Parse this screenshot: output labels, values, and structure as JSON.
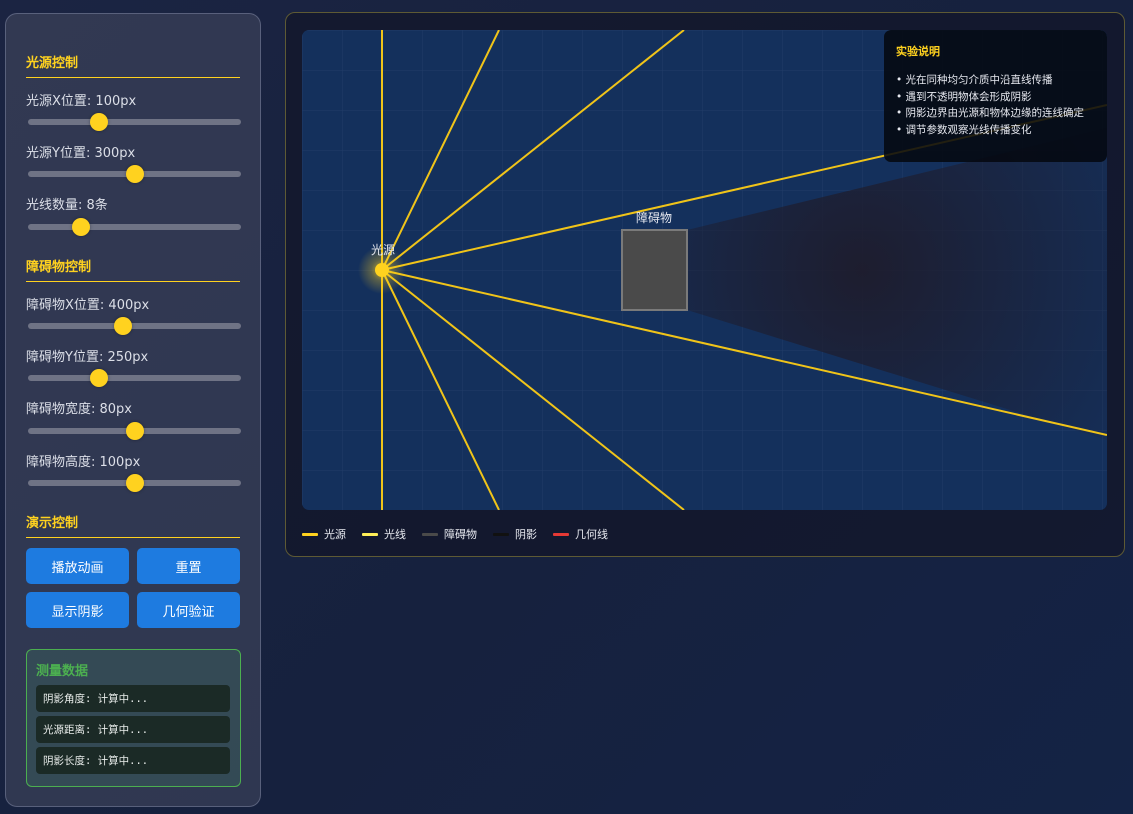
{
  "sidebar": {
    "light_section_title": "光源控制",
    "light_x": {
      "label": "光源X位置: 100px",
      "value": 100,
      "min": 0,
      "max": 300
    },
    "light_y": {
      "label": "光源Y位置: 300px",
      "value": 300,
      "min": 0,
      "max": 600
    },
    "ray_count": {
      "label": "光线数量: 8条",
      "value": 8,
      "min": 2,
      "max": 26
    },
    "obstacle_section_title": "障碍物控制",
    "obstacle_x": {
      "label": "障碍物X位置: 400px",
      "value": 400,
      "min": 0,
      "max": 900
    },
    "obstacle_y": {
      "label": "障碍物Y位置: 250px",
      "value": 250,
      "min": 0,
      "max": 750
    },
    "obstacle_width": {
      "label": "障碍物宽度: 80px",
      "value": 80,
      "min": 0,
      "max": 160
    },
    "obstacle_height": {
      "label": "障碍物高度: 100px",
      "value": 100,
      "min": 0,
      "max": 200
    },
    "demo_section_title": "演示控制",
    "buttons": {
      "play": "播放动画",
      "reset": "重置",
      "shadow": "显示阴影",
      "geometry": "几何验证"
    },
    "measure": {
      "title": "测量数据",
      "shadow_angle": "阴影角度: 计算中...",
      "light_distance": "光源距离: 计算中...",
      "shadow_length": "阴影长度: 计算中..."
    }
  },
  "canvas": {
    "light_label": "光源",
    "obstacle_label": "障碍物",
    "colors": {
      "background": "#14305c",
      "ray": "#ffd21f",
      "obstacle": "#4a4a4a",
      "obstacle_border": "#7a7a7a",
      "light": "#ffd21f"
    },
    "info": {
      "title": "实验说明",
      "lines": [
        "• 光在同种均匀介质中沿直线传播",
        "• 遇到不透明物体会形成阴影",
        "• 阴影边界由光源和物体边缘的连线确定",
        "• 调节参数观察光线传播变化"
      ]
    }
  },
  "legend": [
    {
      "label": "光源",
      "color": "#ffd21f"
    },
    {
      "label": "光线",
      "color": "#ffee58"
    },
    {
      "label": "障碍物",
      "color": "#4a4a4a"
    },
    {
      "label": "阴影",
      "color": "#111111"
    },
    {
      "label": "几何线",
      "color": "#e53935"
    }
  ]
}
